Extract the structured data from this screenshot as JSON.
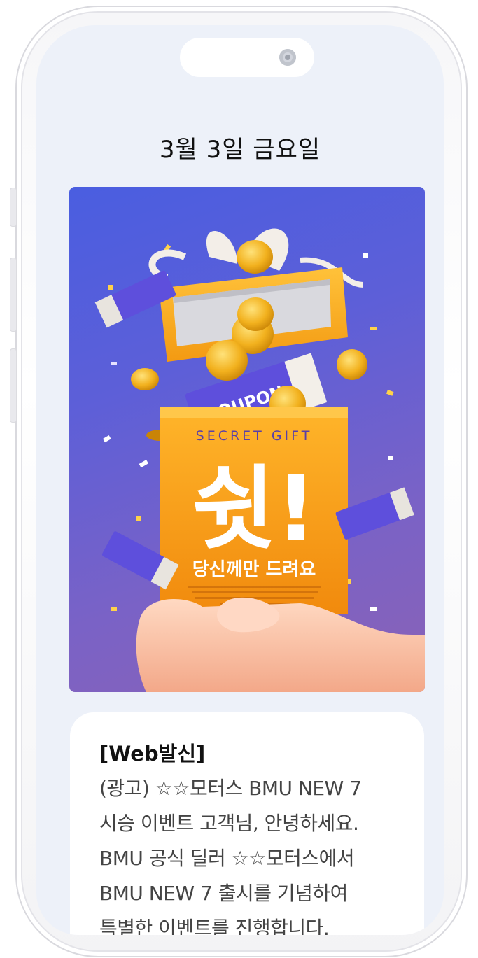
{
  "date_label": "3월 3일 금요일",
  "banner": {
    "secret_text": "SECRET GIFT",
    "big_text": "쉿!",
    "sub_text": "당신께만 드려요",
    "coupon_text": "COUPON",
    "colors": {
      "bg_top": "#4a5ee0",
      "bg_bottom": "#8a62b6",
      "bag": "#f7a51c",
      "coupon": "#5b4fd9"
    }
  },
  "message": {
    "title": "[Web발신]",
    "lines": [
      "(광고) ☆☆모터스 BMU NEW 7",
      "시승 이벤트 고객님, 안녕하세요.",
      "BMU 공식 딜러 ☆☆모터스에서",
      "BMU NEW 7 출시를 기념하여",
      "특별한 이벤트를 진행합니다."
    ]
  }
}
